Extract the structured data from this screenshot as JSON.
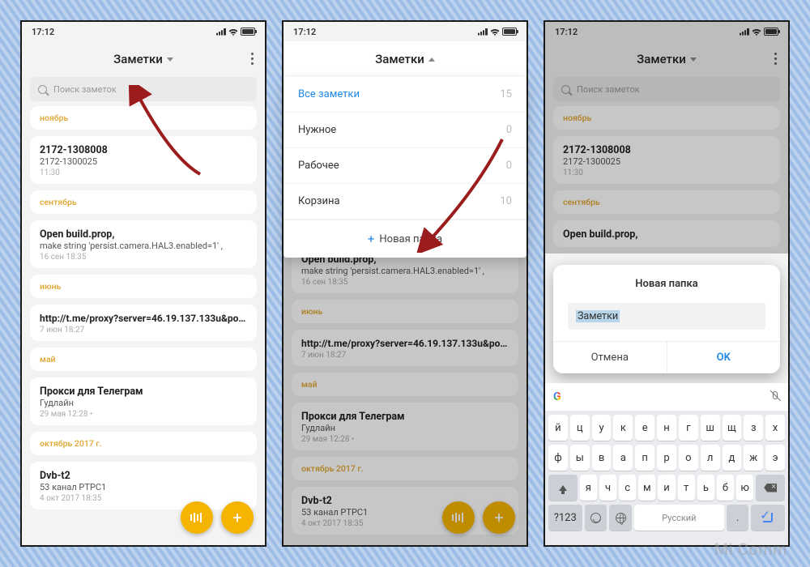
{
  "status_time": "17:12",
  "app_title": "Заметки",
  "search_placeholder": "Поиск заметок",
  "months": {
    "nov": "ноябрь",
    "sep": "сентябрь",
    "jun": "июнь",
    "may": "май",
    "oct17": "октябрь 2017 г."
  },
  "notes": {
    "n1": {
      "title": "2172-1308008",
      "sub": "2172-1300025",
      "time": "11:30"
    },
    "n2": {
      "title": "Open build.prop,",
      "sub": "make string 'persist.camera.HAL3.enabled=1' ,",
      "time": "16 сен 18:35"
    },
    "n3": {
      "title": "http://t.me/proxy?server=46.19.137.133u&port…",
      "time": "7 июн 18:27"
    },
    "n4": {
      "title": "Прокси для Телеграм",
      "sub": "Гудлайн",
      "time": "29 мая 12:28  •"
    },
    "n5": {
      "title": "Dvb-t2",
      "sub": "53 канал РТРС1",
      "time": "4 окт 2017 18:35"
    }
  },
  "dropdown": {
    "items": [
      {
        "label": "Все заметки",
        "count": "15",
        "active": true
      },
      {
        "label": "Нужное",
        "count": "0"
      },
      {
        "label": "Рабочее",
        "count": "0"
      },
      {
        "label": "Корзина",
        "count": "10"
      }
    ],
    "add": "Новая папка"
  },
  "dialog": {
    "title": "Новая папка",
    "value": "Заметки",
    "cancel": "Отмена",
    "ok": "OK"
  },
  "keyboard": {
    "lang": "Русский",
    "numkey": "?123",
    "rows": [
      [
        "й",
        "ц",
        "у",
        "к",
        "е",
        "н",
        "г",
        "ш",
        "щ",
        "з",
        "х"
      ],
      [
        "ф",
        "ы",
        "в",
        "а",
        "п",
        "р",
        "о",
        "л",
        "д",
        "ж",
        "э"
      ],
      [
        "я",
        "ч",
        "с",
        "м",
        "и",
        "т",
        "ь",
        "б",
        "ю"
      ]
    ]
  },
  "watermark": "Mi Comm"
}
